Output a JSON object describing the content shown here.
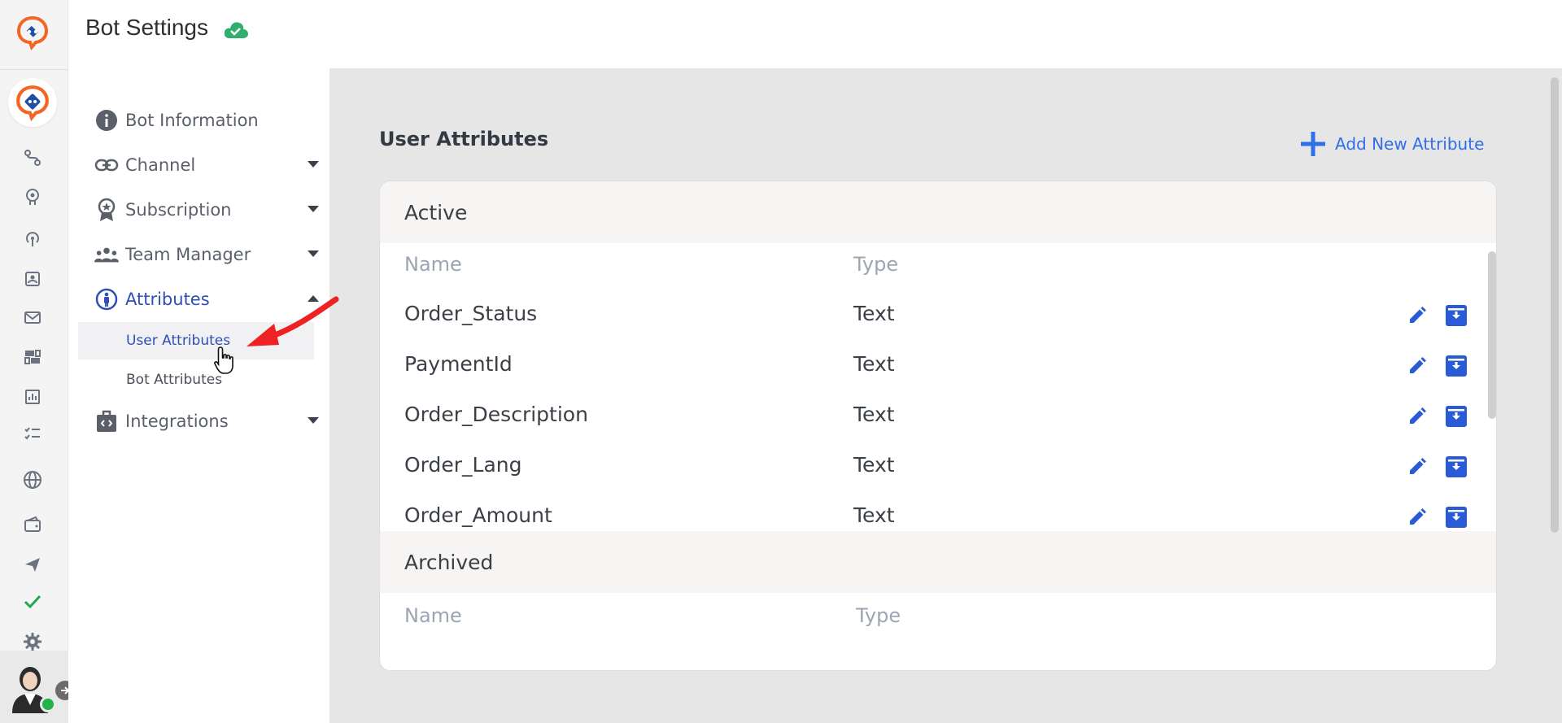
{
  "header": {
    "title": "Bot Settings",
    "status_icon": "cloud-check-icon"
  },
  "rail": {
    "icons": [
      "flow-icon",
      "brain-icon",
      "broadcast-icon",
      "contacts-icon",
      "mail-icon",
      "dashboard-icon",
      "analytics-icon",
      "checklist-icon",
      "globe-icon",
      "wallet-icon",
      "send-icon",
      "check-icon",
      "settings-icon"
    ]
  },
  "nav": {
    "items": [
      {
        "label": "Bot Information",
        "icon": "info-icon"
      },
      {
        "label": "Channel",
        "icon": "link-icon"
      },
      {
        "label": "Subscription",
        "icon": "badge-icon"
      },
      {
        "label": "Team Manager",
        "icon": "team-icon"
      },
      {
        "label": "Attributes",
        "icon": "person-circle-icon"
      },
      {
        "label": "Integrations",
        "icon": "code-bag-icon"
      }
    ],
    "sub_items": [
      {
        "label": "User Attributes"
      },
      {
        "label": "Bot Attributes"
      }
    ]
  },
  "main": {
    "title": "User Attributes",
    "add_label": "Add New Attribute",
    "active": {
      "heading": "Active",
      "col_name": "Name",
      "col_type": "Type",
      "rows": [
        {
          "name": "Order_Status",
          "type": "Text"
        },
        {
          "name": "PaymentId",
          "type": "Text"
        },
        {
          "name": "Order_Description",
          "type": "Text"
        },
        {
          "name": "Order_Lang",
          "type": "Text"
        },
        {
          "name": "Order_Amount",
          "type": "Text"
        }
      ]
    },
    "archived": {
      "heading": "Archived",
      "col_name": "Name",
      "col_type": "Type"
    }
  },
  "colors": {
    "accent": "#2f6fe8",
    "brand": "#f26522",
    "nav_active": "#2f4fb8",
    "online": "#22b24c"
  }
}
